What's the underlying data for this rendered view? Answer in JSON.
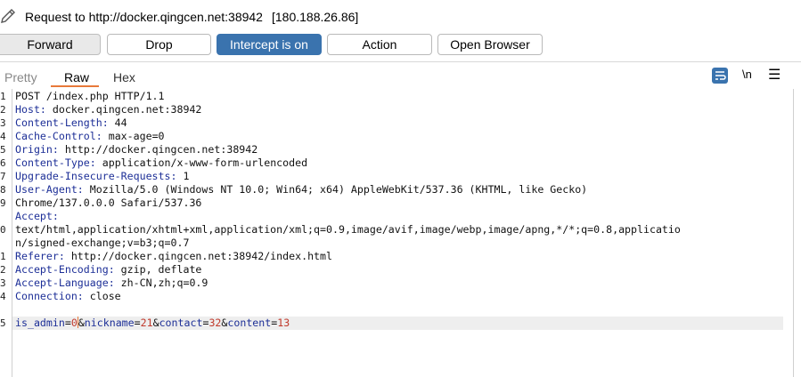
{
  "request": {
    "label": "Request to http://docker.qingcen.net:38942",
    "ip": "[180.188.26.86]"
  },
  "toolbar": {
    "forward": "Forward",
    "drop": "Drop",
    "intercept": "Intercept is on",
    "action": "Action",
    "open_browser": "Open Browser"
  },
  "tabs": {
    "pretty": "Pretty",
    "raw": "Raw",
    "hex": "Hex",
    "active": "Raw"
  },
  "icons": {
    "wrap": "word-wrap-icon",
    "newline": "\\n",
    "menu": "☰"
  },
  "colors": {
    "accent": "#3a73ae",
    "tab_underline": "#e8793a",
    "header_key": "#1d2f97",
    "param_value": "#c0392b"
  },
  "editor": {
    "line_numbers": [
      "1",
      "2",
      "3",
      "4",
      "5",
      "6",
      "7",
      "8",
      "9",
      "",
      "0",
      "",
      "1",
      "2",
      "3",
      "4",
      "",
      "5"
    ],
    "lines": [
      {
        "plain": "POST /index.php HTTP/1.1"
      },
      {
        "key": "Host:",
        "val": " docker.qingcen.net:38942"
      },
      {
        "key": "Content-Length:",
        "val": " 44"
      },
      {
        "key": "Cache-Control:",
        "val": " max-age=0"
      },
      {
        "key": "Origin:",
        "val": " http://docker.qingcen.net:38942"
      },
      {
        "key": "Content-Type:",
        "val": " application/x-www-form-urlencoded"
      },
      {
        "key": "Upgrade-Insecure-Requests:",
        "val": " 1"
      },
      {
        "key": "User-Agent:",
        "val": " Mozilla/5.0 (Windows NT 10.0; Win64; x64) AppleWebKit/537.36 (KHTML, like Gecko)"
      },
      {
        "plain": "Chrome/137.0.0.0 Safari/537.36"
      },
      {
        "key": "Accept:",
        "val": ""
      },
      {
        "plain": "text/html,application/xhtml+xml,application/xml;q=0.9,image/avif,image/webp,image/apng,*/*;q=0.8,applicatio"
      },
      {
        "plain": "n/signed-exchange;v=b3;q=0.7"
      },
      {
        "key": "Referer:",
        "val": " http://docker.qingcen.net:38942/index.html"
      },
      {
        "key": "Accept-Encoding:",
        "val": " gzip, deflate"
      },
      {
        "key": "Accept-Language:",
        "val": " zh-CN,zh;q=0.9"
      },
      {
        "key": "Connection:",
        "val": " close"
      },
      {
        "plain": ""
      },
      {
        "body": [
          {
            "k": "is_admin",
            "v": "0"
          },
          {
            "k": "nickname",
            "v": "21"
          },
          {
            "k": "contact",
            "v": "32"
          },
          {
            "k": "content",
            "v": "13"
          }
        ]
      }
    ]
  }
}
